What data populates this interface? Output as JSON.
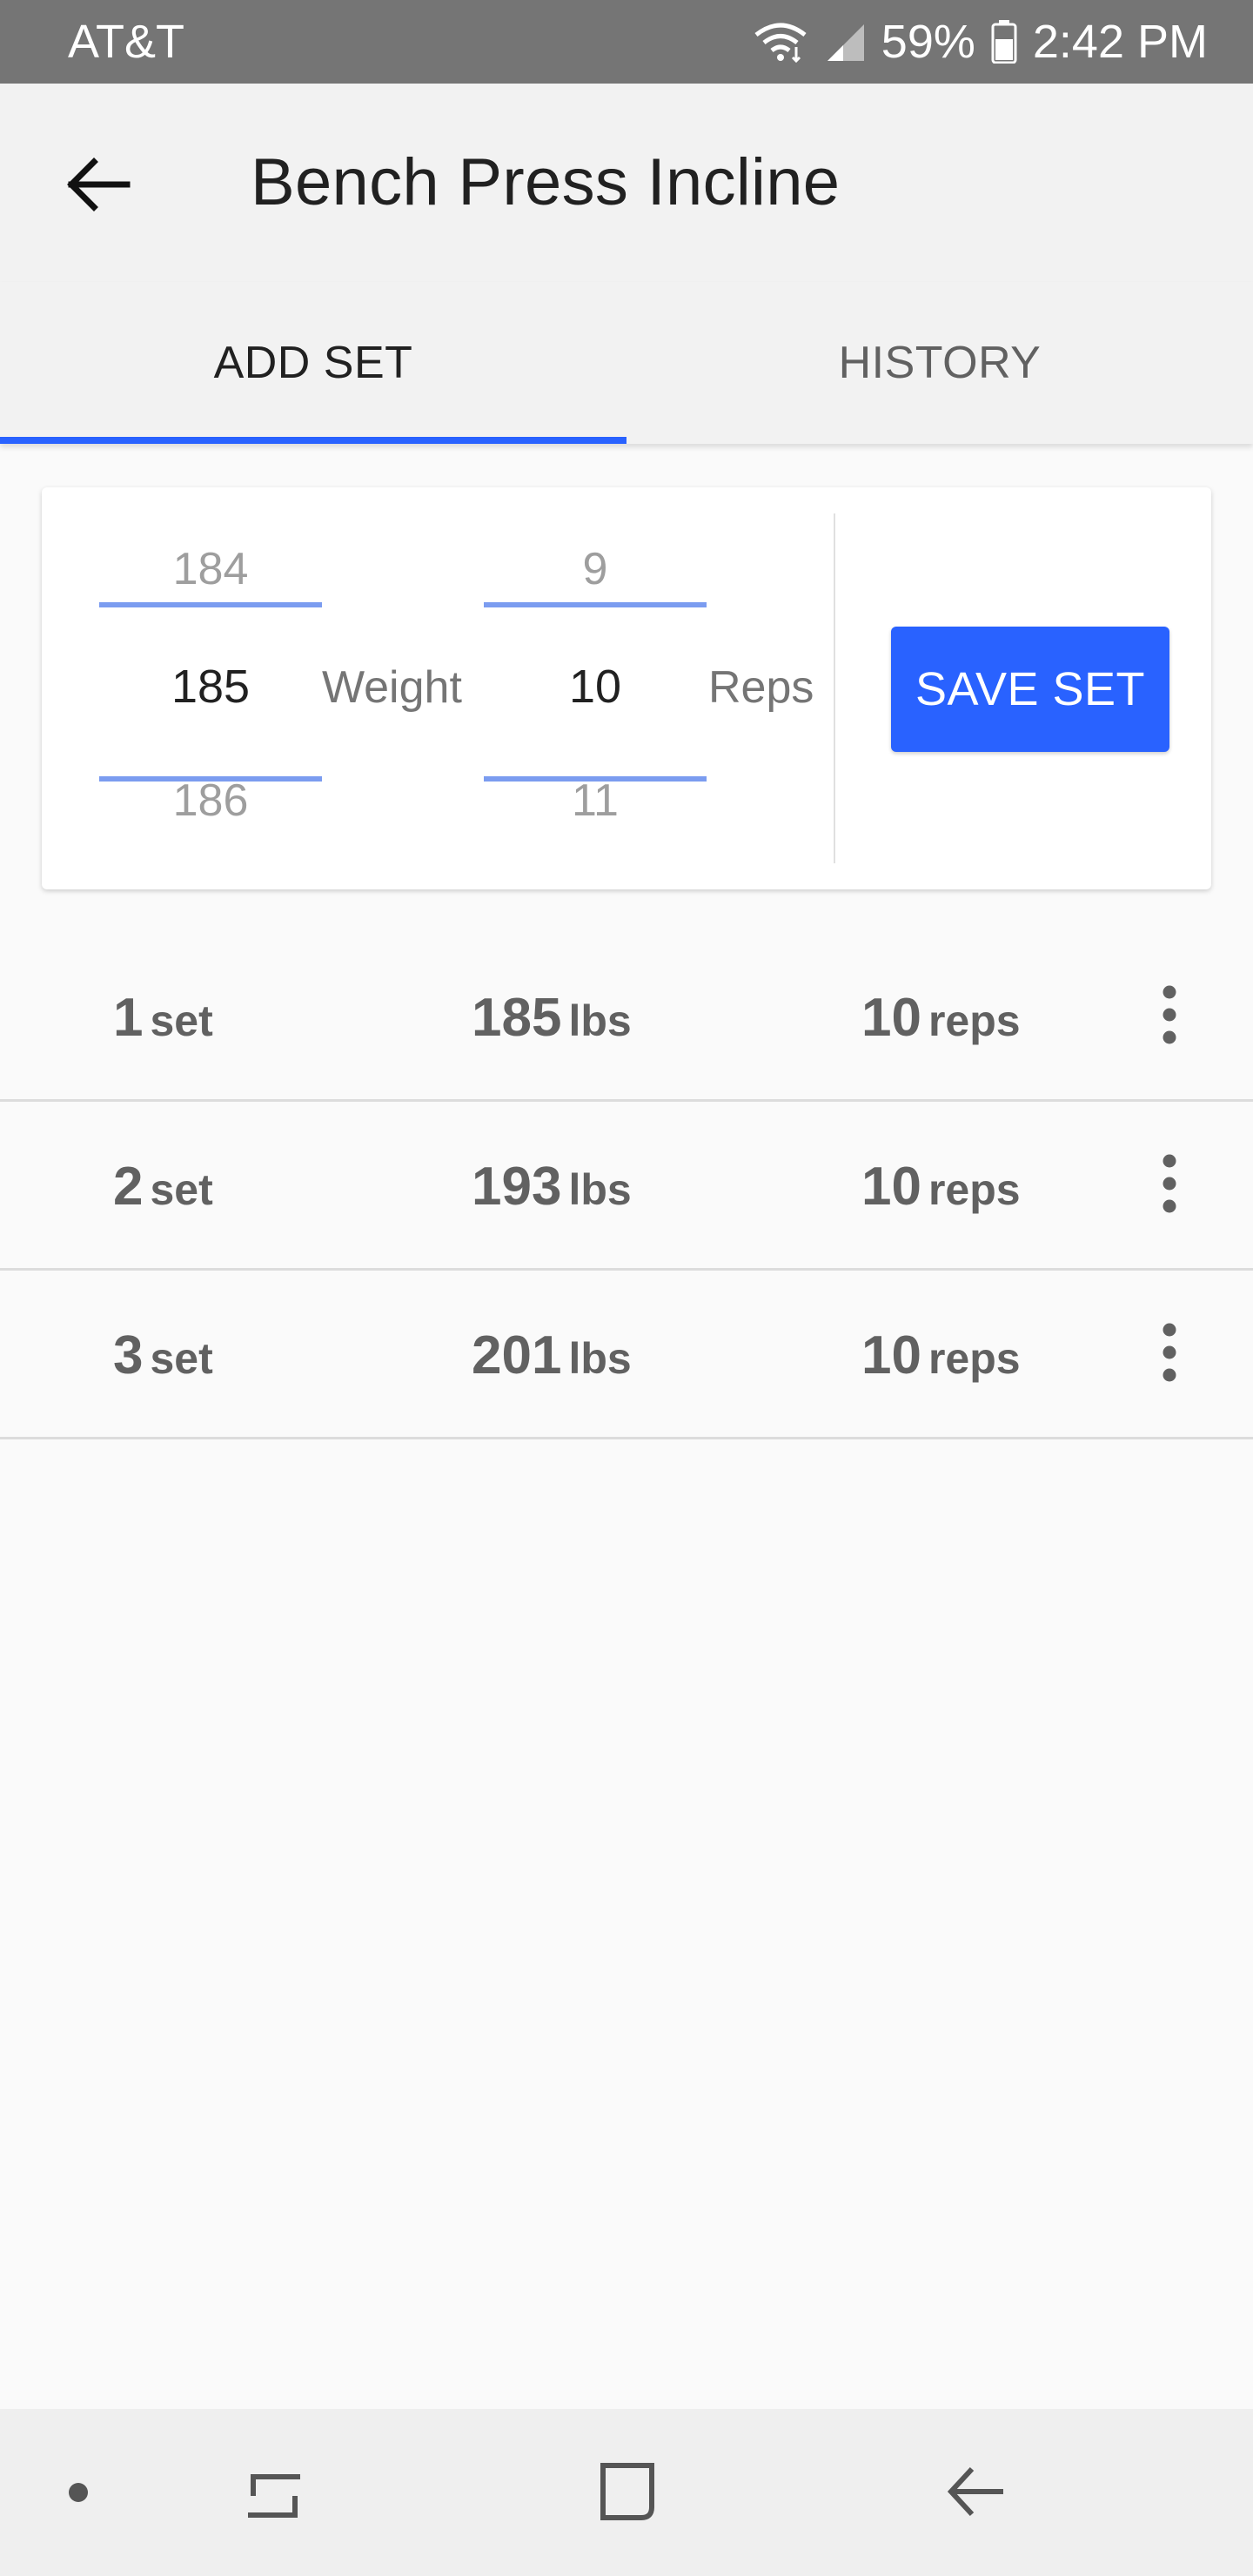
{
  "status_bar": {
    "carrier": "AT&T",
    "battery": "59%",
    "time": "2:42 PM",
    "icons": [
      "wifi-icon",
      "signal-icon",
      "battery-icon"
    ]
  },
  "app_bar": {
    "title": "Bench Press Incline",
    "back_icon": "arrow-back-icon"
  },
  "tabs": [
    {
      "label": "ADD SET",
      "active": true
    },
    {
      "label": "HISTORY",
      "active": false
    }
  ],
  "add_set": {
    "weight": {
      "above": "184",
      "current": "185",
      "below": "186",
      "label": "Weight"
    },
    "reps": {
      "above": "9",
      "current": "10",
      "below": "11",
      "label": "Reps"
    },
    "save_label": "SAVE SET"
  },
  "sets": [
    {
      "number": "1",
      "set_unit": "set",
      "weight": "185",
      "weight_unit": "lbs",
      "reps": "10",
      "reps_unit": "reps"
    },
    {
      "number": "2",
      "set_unit": "set",
      "weight": "193",
      "weight_unit": "lbs",
      "reps": "10",
      "reps_unit": "reps"
    },
    {
      "number": "3",
      "set_unit": "set",
      "weight": "201",
      "weight_unit": "lbs",
      "reps": "10",
      "reps_unit": "reps"
    }
  ],
  "nav_bar": {
    "icons": [
      "dot-icon",
      "recents-icon",
      "home-icon",
      "back-icon"
    ]
  },
  "colors": {
    "accent": "#2962ff",
    "status_bar": "#757575",
    "app_bar": "#f2f2f2",
    "text_primary": "#212121",
    "text_secondary": "#616161"
  }
}
